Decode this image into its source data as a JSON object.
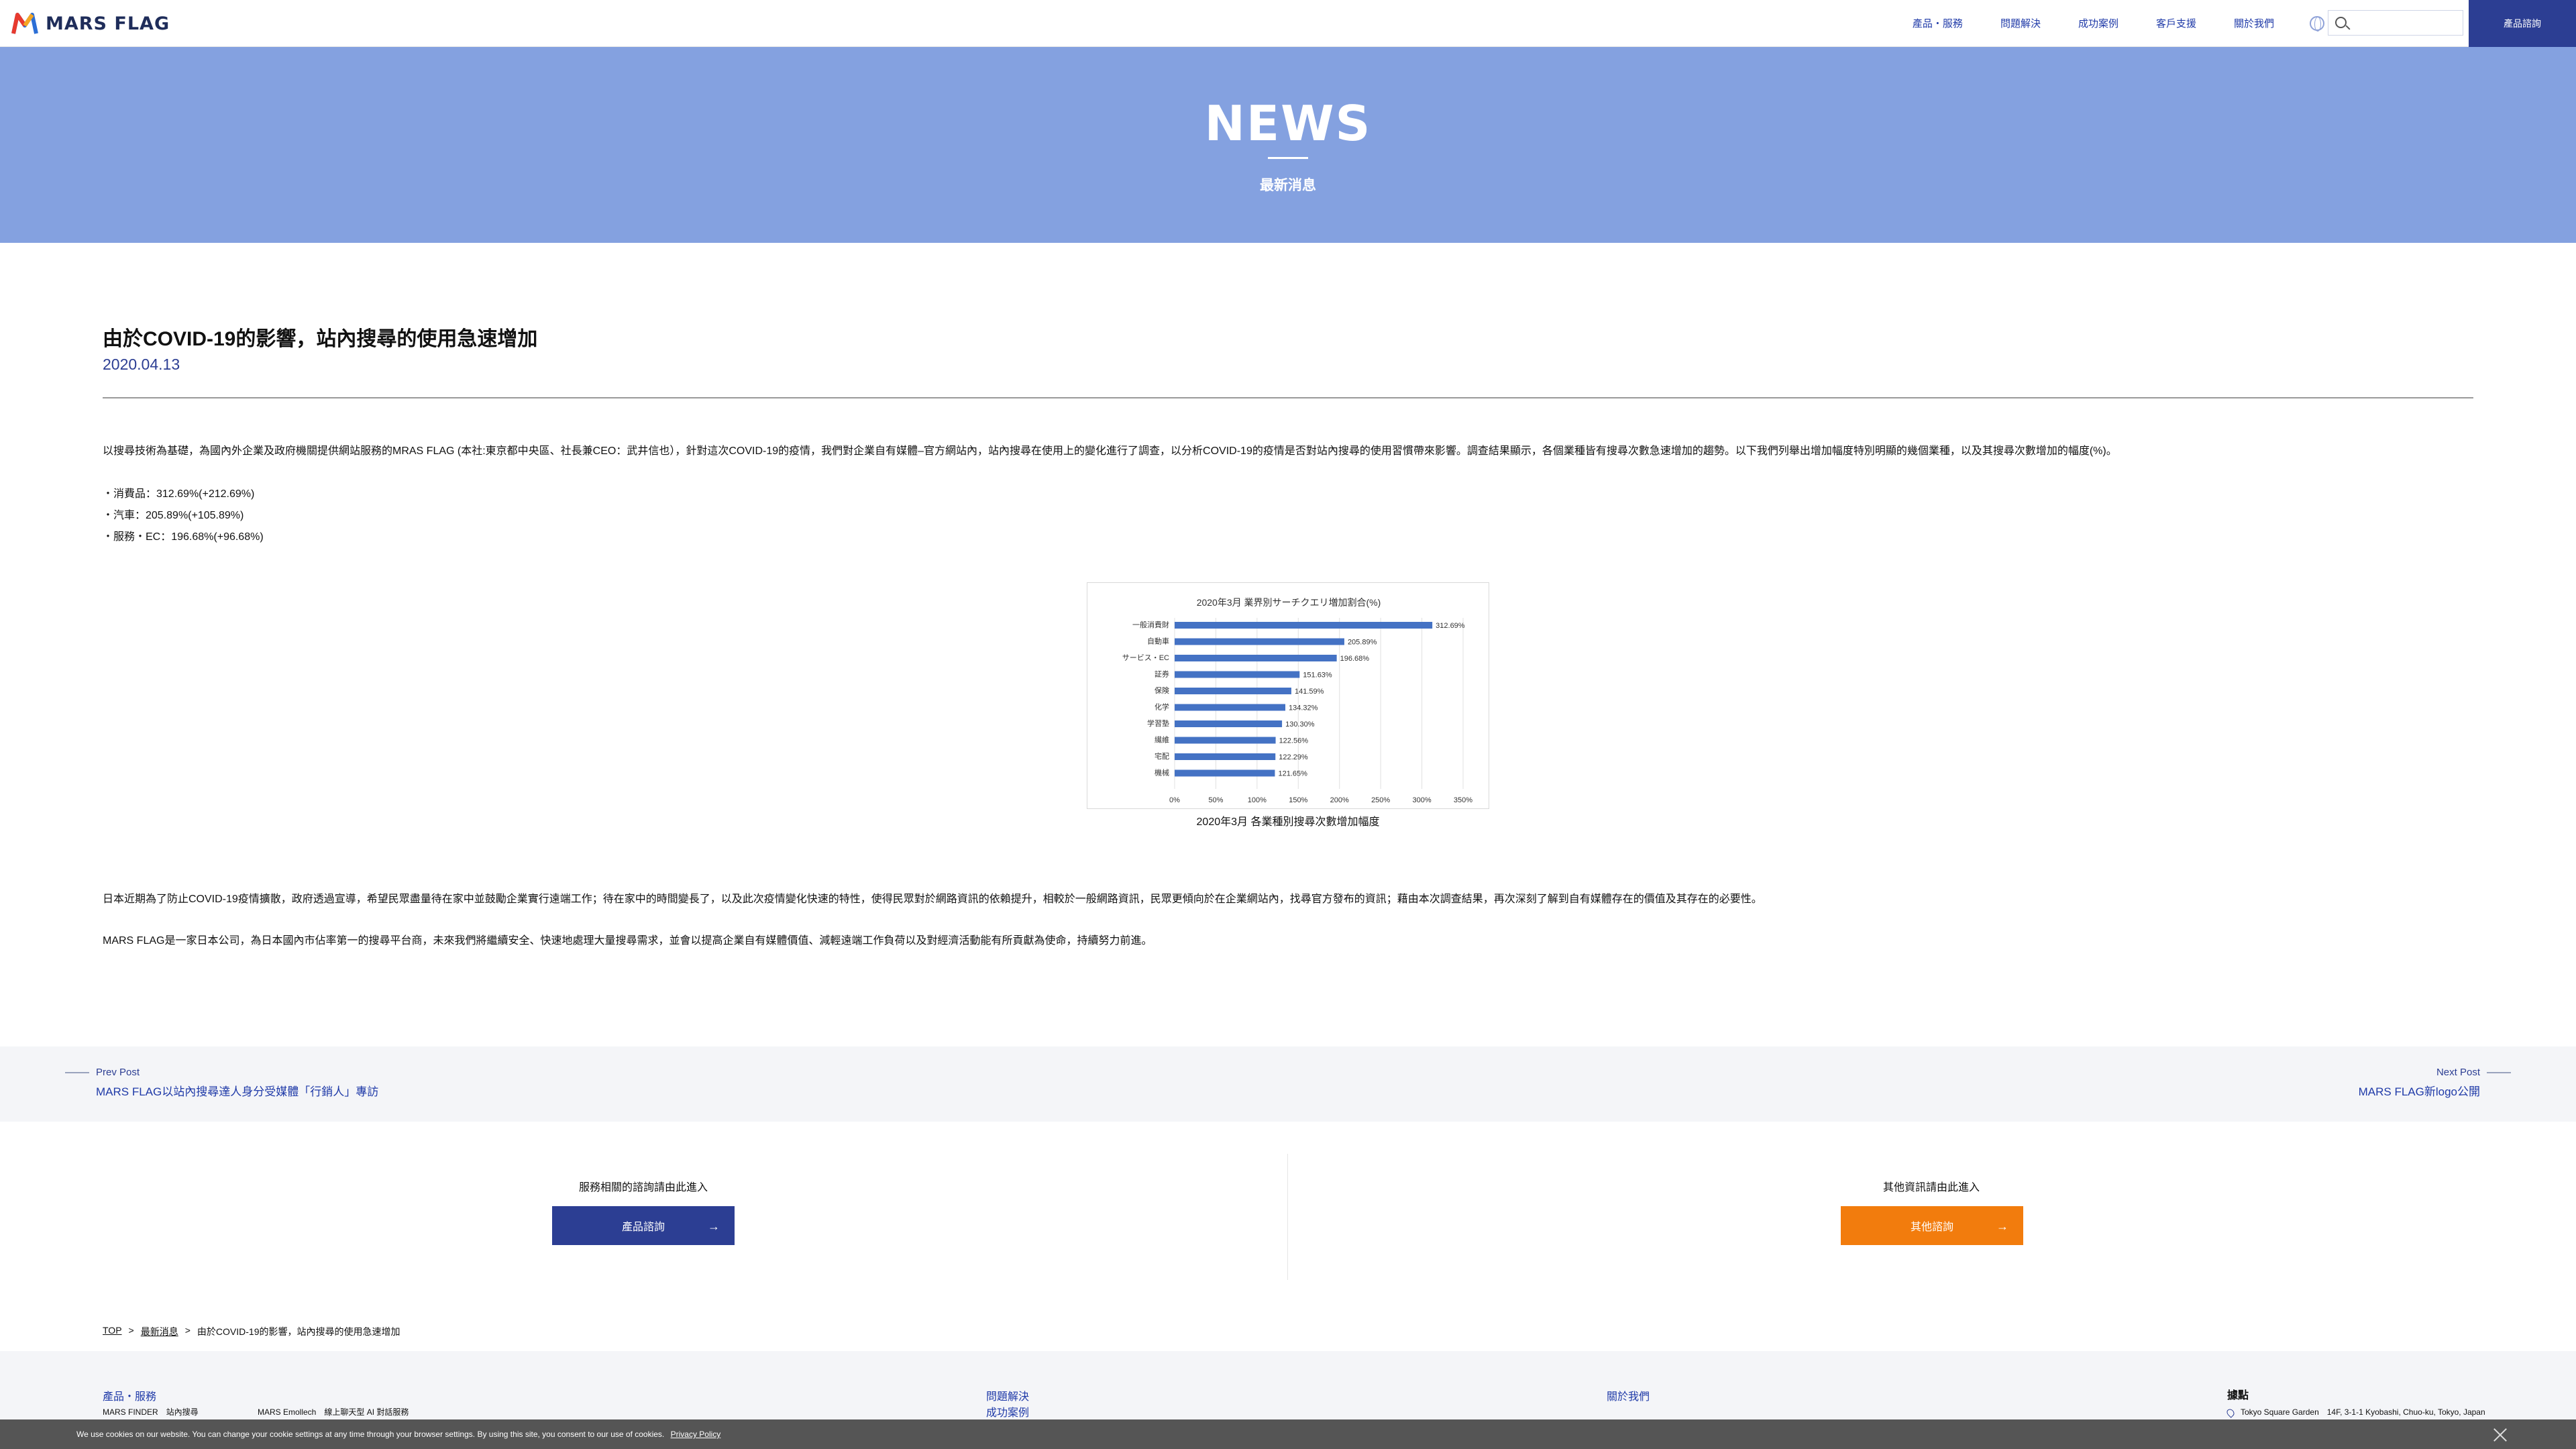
{
  "header": {
    "logo_text": "MARS FLAG",
    "nav": [
      "產品・服務",
      "問題解決",
      "成功案例",
      "客戶支援",
      "關於我們"
    ],
    "search_placeholder": "",
    "cta_label": "產品諮詢"
  },
  "banner": {
    "title": "NEWS",
    "subtitle": "最新消息"
  },
  "article": {
    "title": "由於COVID-19的影響，站內搜尋的使用急速增加",
    "date": "2020.04.13",
    "intro": "以搜尋技術為基礎，為國內外企業及政府機關提供網站服務的MRAS FLAG (本社:東京都中央區、社長兼CEO：武井信也），針對這次COVID-19的疫情，我們對企業自有媒體–官方網站內，站內搜尋在使用上的變化進行了調查，以分析COVID-19的疫情是否對站內搜尋的使用習慣帶來影響。調查結果顯示，各個業種皆有搜尋次數急速增加的趨勢。以下我們列舉出增加幅度特別明顯的幾個業種，以及其搜尋次數增加的幅度(%)。",
    "bullets": [
      "・消費品：312.69%(+212.69%)",
      "・汽車：205.89%(+105.89%)",
      "・服務・EC：196.68%(+96.68%)"
    ],
    "chart_caption": "2020年3月  各業種別搜尋次數增加幅度",
    "para2": "日本近期為了防止COVID-19疫情擴散，政府透過宣導，希望民眾盡量待在家中並鼓勵企業實行遠端工作；待在家中的時間變長了，以及此次疫情變化快速的特性，使得民眾對於網路資訊的依賴提升，相較於一般網路資訊，民眾更傾向於在企業網站內，找尋官方發布的資訊；藉由本次調查結果，再次深刻了解到自有媒體存在的價值及其存在的必要性。",
    "para3": "MARS FLAG是一家日本公司，為日本國內市佔率第一的搜尋平台商，未來我們將繼續安全、快速地處理大量搜尋需求，並會以提高企業自有媒體價值、減輕遠端工作負荷以及對經濟活動能有所貢獻為使命，持續努力前進。"
  },
  "chart_data": {
    "type": "bar",
    "orientation": "horizontal",
    "title": "2020年3月 業界別サーチクエリ増加割合(%)",
    "categories": [
      "一般消費財",
      "自動車",
      "サービス・EC",
      "証券",
      "保険",
      "化学",
      "学習塾",
      "繊維",
      "宅配",
      "機械"
    ],
    "values": [
      312.69,
      205.89,
      196.68,
      151.63,
      141.59,
      134.32,
      130.3,
      122.56,
      122.29,
      121.65
    ],
    "value_labels": [
      "312.69%",
      "205.89%",
      "196.68%",
      "151.63%",
      "141.59%",
      "134.32%",
      "130.30%",
      "122.56%",
      "122.29%",
      "121.65%"
    ],
    "x_ticks": [
      "0%",
      "50%",
      "100%",
      "150%",
      "200%",
      "250%",
      "300%",
      "350%"
    ],
    "xlim": [
      0,
      350
    ],
    "grid": true,
    "bar_color": "#4472c4"
  },
  "postnav": {
    "prev_label": "Prev Post",
    "prev_title": "MARS FLAG以站內搜尋達人身分受媒體「行銷人」專訪",
    "next_label": "Next Post",
    "next_title": "MARS FLAG新logo公開"
  },
  "contact": {
    "left_label": "服務相關的諮詢請由此進入",
    "left_button": "產品諮詢",
    "right_label": "其他資訊請由此進入",
    "right_button": "其他諮詢",
    "left_color": "#2c3e93",
    "right_color": "#f27c0d"
  },
  "breadcrumb": {
    "top": "TOP",
    "news": "最新消息",
    "current": "由於COVID-19的影響，站內搜尋的使用急速增加",
    "sep": ">"
  },
  "footer": {
    "col1_title": "產品・服務",
    "col1_item1": "MARS FINDER　站內搜尋",
    "col1_item2": "MARS Emollech　線上聊天型 AI 對話服務",
    "col2_link1": "問題解決",
    "col2_link2": "成功案例",
    "col3_title": "關於我們",
    "col4_title": "據點",
    "col4_addr1": "Tokyo Square Garden　14F, 3-1-1 Kyobashi, Chuo-ku, Tokyo, Japan"
  },
  "cookie": {
    "text": "We use cookies on our website. You can change your cookie settings at any time through your browser settings. By using this site, you consent to our use of cookies.",
    "link": "Privacy Policy"
  }
}
